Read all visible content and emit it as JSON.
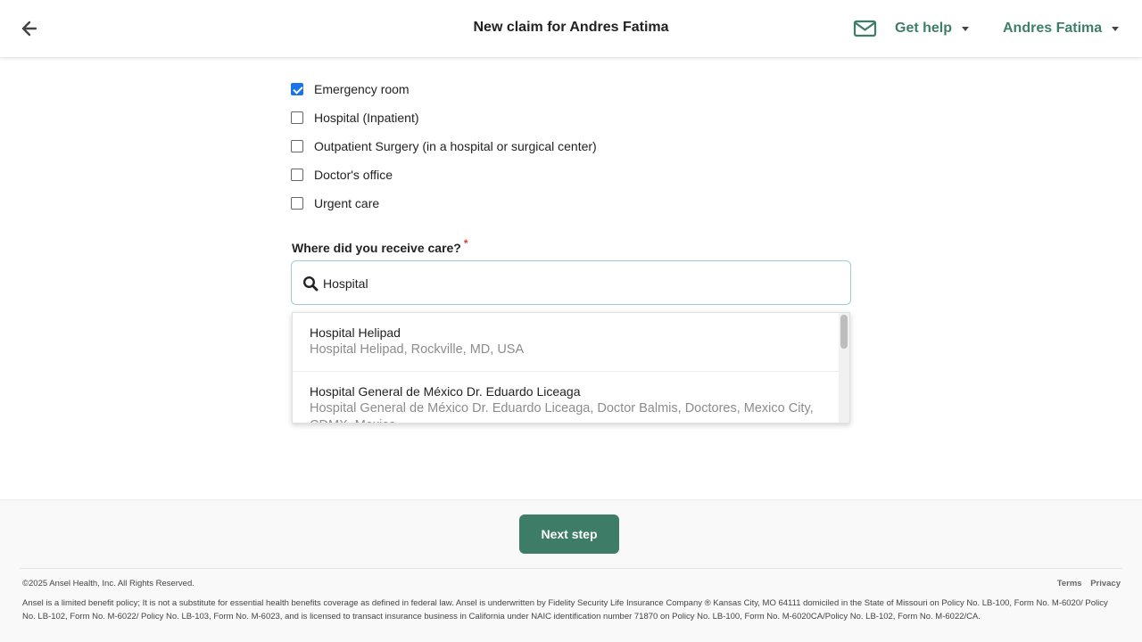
{
  "header": {
    "title": "New claim for Andres Fatima",
    "help_label": "Get help",
    "user_name": "Andres Fatima"
  },
  "care_types": [
    {
      "label": "Emergency room",
      "checked": true
    },
    {
      "label": "Hospital (Inpatient)",
      "checked": false
    },
    {
      "label": "Outpatient Surgery (in a hospital or surgical center)",
      "checked": false
    },
    {
      "label": "Doctor's office",
      "checked": false
    },
    {
      "label": "Urgent care",
      "checked": false
    }
  ],
  "location_field": {
    "label": "Where did you receive care?",
    "required_mark": "*",
    "value": "Hospital"
  },
  "suggestions": [
    {
      "name": "Hospital Helipad",
      "address": "Hospital Helipad, Rockville, MD, USA"
    },
    {
      "name": "Hospital General de México Dr. Eduardo Liceaga",
      "address": "Hospital General de México Dr. Eduardo Liceaga, Doctor Balmis, Doctores, Mexico City, CDMX, Mexico"
    }
  ],
  "footer": {
    "next_label": "Next step",
    "copyright": "©2025 Ansel Health, Inc. All Rights Reserved.",
    "terms": "Terms",
    "privacy": "Privacy",
    "disclaimer": "Ansel is a limited benefit policy; It is not a substitute for essential health benefits coverage as defined in federal law. Ansel is underwritten by Fidelity Security Life Insurance Company ® Kansas City, MO 64111 domiciled in the State of Missouri on Policy No. LB-100, Form No. M-6020/ Policy No. LB-102, Form No. M-6022/ Policy No. LB-103, Form No. M-6023, and is licensed to transact insurance business in California under NAIC identification number 71870 on Policy No. LB-100, Form No. M-6020CA/Policy No. LB-102, Form No. M-6022/CA."
  },
  "colors": {
    "brand_green": "#3d7c66",
    "checkbox_blue": "#1a73e8",
    "required_red": "#dd3333"
  }
}
